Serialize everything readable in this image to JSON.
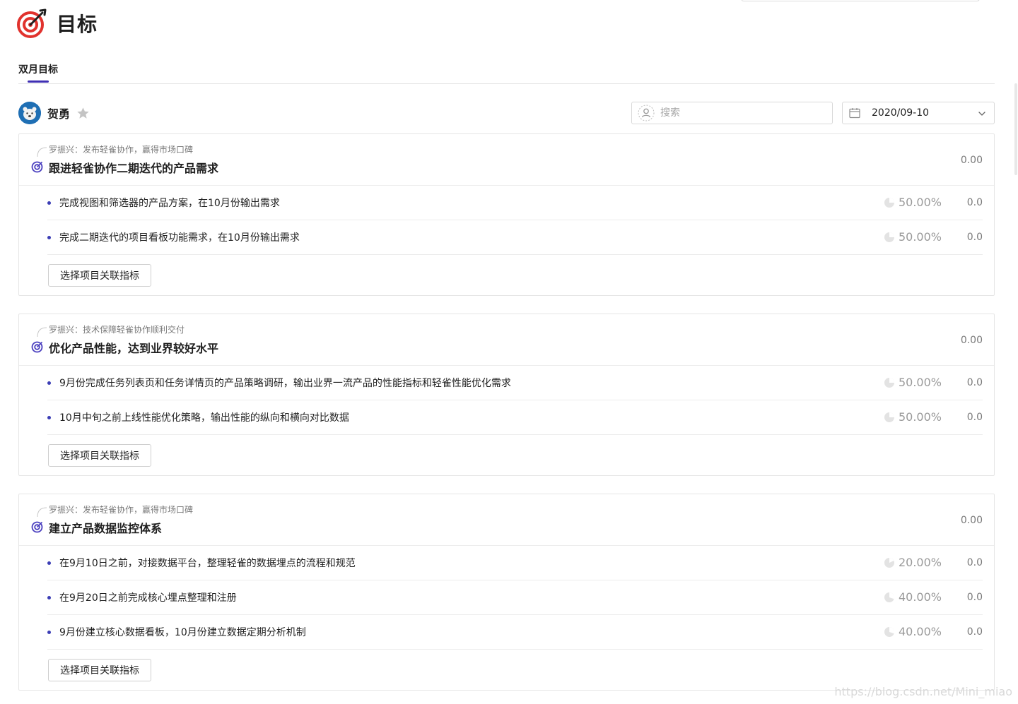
{
  "page": {
    "title": "目标"
  },
  "tabs": [
    {
      "label": "双月目标",
      "active": true
    }
  ],
  "user": {
    "name": "贺勇"
  },
  "search": {
    "placeholder": "搜索"
  },
  "date_picker": {
    "value": "2020/09-10"
  },
  "colors": {
    "accent": "#3f2fb3",
    "logo_red": "#e1322d",
    "dot": "#3b3db5"
  },
  "goals": [
    {
      "parent": "罗振兴：发布轻雀协作，赢得市场口碑",
      "title": "跟进轻雀协作二期迭代的产品需求",
      "score": "0.00",
      "key_results": [
        {
          "text": "完成视图和筛选器的产品方案，在10月份输出需求",
          "progress": "50.00%",
          "score": "0.0"
        },
        {
          "text": "完成二期迭代的项目看板功能需求，在10月份输出需求",
          "progress": "50.00%",
          "score": "0.0"
        }
      ],
      "button_label": "选择项目关联指标"
    },
    {
      "parent": "罗振兴：技术保障轻雀协作顺利交付",
      "title": "优化产品性能，达到业界较好水平",
      "score": "0.00",
      "key_results": [
        {
          "text": "9月份完成任务列表页和任务详情页的产品策略调研，输出业界一流产品的性能指标和轻雀性能优化需求",
          "progress": "50.00%",
          "score": "0.0"
        },
        {
          "text": "10月中旬之前上线性能优化策略，输出性能的纵向和横向对比数据",
          "progress": "50.00%",
          "score": "0.0"
        }
      ],
      "button_label": "选择项目关联指标"
    },
    {
      "parent": "罗振兴：发布轻雀协作，赢得市场口碑",
      "title": "建立产品数据监控体系",
      "score": "0.00",
      "key_results": [
        {
          "text": "在9月10日之前，对接数据平台，整理轻雀的数据埋点的流程和规范",
          "progress": "20.00%",
          "score": "0.0"
        },
        {
          "text": "在9月20日之前完成核心埋点整理和注册",
          "progress": "40.00%",
          "score": "0.0"
        },
        {
          "text": "9月份建立核心数据看板，10月份建立数据定期分析机制",
          "progress": "40.00%",
          "score": "0.0"
        }
      ],
      "button_label": "选择项目关联指标"
    }
  ],
  "watermark": "https://blog.csdn.net/Mini_miao"
}
